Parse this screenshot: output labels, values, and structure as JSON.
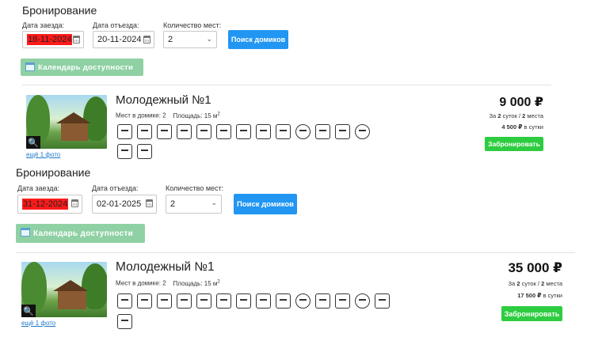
{
  "blocks": [
    {
      "title": "Бронирование",
      "checkin_label": "Дата заезда:",
      "checkin_value": "18-11-2024",
      "checkout_label": "Дата отъезда:",
      "checkout_value": "20-11-2024",
      "guests_label": "Количество мест:",
      "guests_value": "2",
      "search_label": "Поиск домиков",
      "calendar_label": "Календарь доступности",
      "house": {
        "name": "Молодежный №1",
        "more_photos": "ещё 1 фото",
        "places": "Мест в домике: 2",
        "area_prefix": "Площадь: 15 м",
        "area_sup": "2",
        "price": "9 000 ₽",
        "period_pre": "За ",
        "period_days": "2",
        "period_mid": " суток / ",
        "period_places": "2",
        "period_post": " места",
        "per_day_amount": "4 500 ₽",
        "per_day_suffix": " в сутки",
        "book_label": "Забронировать"
      }
    },
    {
      "title": "Бронирование",
      "checkin_label": "Дата заезда:",
      "checkin_value": "31-12-2024",
      "checkout_label": "Дата отъезда:",
      "checkout_value": "02-01-2025",
      "guests_label": "Количество мест:",
      "guests_value": "2",
      "search_label": "Поиск домиков",
      "calendar_label": "Календарь доступности",
      "house": {
        "name": "Молодежный №1",
        "more_photos": "ещё 1 фото",
        "places": "Мест в домике: 2",
        "area_prefix": "Площадь: 15 м",
        "area_sup": "2",
        "price": "35 000 ₽",
        "period_pre": "За ",
        "period_days": "2",
        "period_mid": " суток / ",
        "period_places": "2",
        "period_post": " места",
        "per_day_amount": "17 500 ₽",
        "per_day_suffix": " в сутки",
        "book_label": "Забронировать"
      }
    }
  ],
  "amenities": [
    "tv-icon",
    "kitchen-sink-icon",
    "shower-icon",
    "fridge-icon",
    "hairdryer-icon",
    "stove-icon",
    "kettle-icon",
    "microwave-icon",
    "bed-icon",
    "no-smoking-icon",
    "parking-icon",
    "dining-table-icon",
    "dishes-icon",
    "table-icon",
    "toilet-icon"
  ],
  "colors": {
    "search": "#2196f3",
    "calendar": "#8fd1a4",
    "book": "#2ecc40",
    "date_highlight": "#ff1a1a",
    "link": "#1e78c8"
  }
}
